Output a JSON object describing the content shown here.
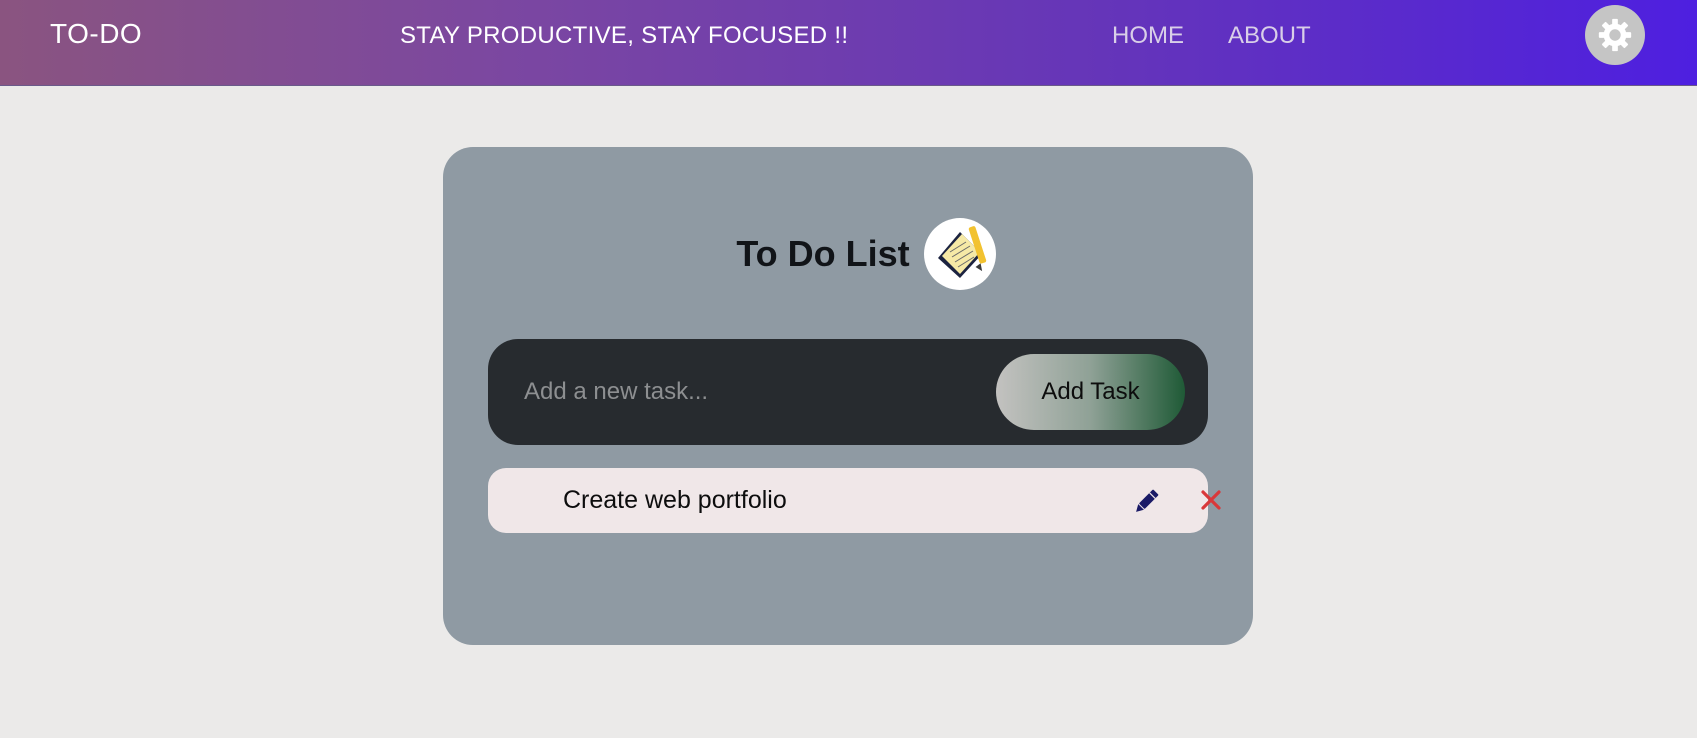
{
  "navbar": {
    "brand": "TO-DO",
    "slogan": "STAY PRODUCTIVE, STAY FOCUSED !!",
    "links": [
      {
        "label": "HOME"
      },
      {
        "label": "ABOUT"
      }
    ],
    "settings_icon": "gear-icon"
  },
  "card": {
    "title": "To Do List",
    "title_icon": "notepad-pencil-icon",
    "input": {
      "placeholder": "Add a new task...",
      "value": ""
    },
    "add_button_label": "Add Task",
    "tasks": [
      {
        "text": "Create web portfolio",
        "edit_icon": "pencil-icon",
        "delete_icon": "close-icon"
      }
    ]
  },
  "colors": {
    "navbar_gradient_start": "#8a5480",
    "navbar_gradient_end": "#4e1fe0",
    "card_bg": "#8f9aa3",
    "input_bar_bg": "#272b2f",
    "task_bg": "#f0e7e8",
    "edit_icon": "#1a1a66",
    "delete_icon": "#d9383a"
  }
}
